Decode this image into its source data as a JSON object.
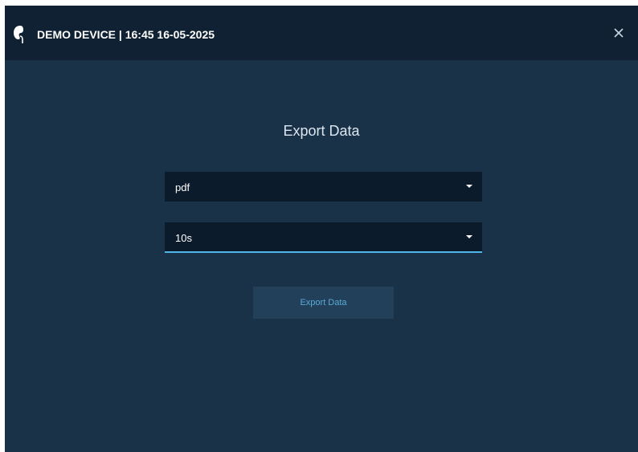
{
  "titlebar": {
    "title": "DEMO DEVICE | 16:45 16-05-2025",
    "app_icon": "kidney-icon",
    "close_icon": "close-icon"
  },
  "dialog": {
    "heading": "Export Data",
    "format_select": {
      "value": "pdf",
      "icon": "caret-down-icon"
    },
    "duration_select": {
      "value": "10s",
      "icon": "caret-down-icon"
    },
    "export_button_label": "Export Data"
  },
  "colors": {
    "background": "#1a3248",
    "titlebar": "#0f2132",
    "select_background": "#0c1b2b",
    "focus_underline": "#4fb7ea",
    "button_background": "#22405a",
    "button_text": "#5aa9d6"
  }
}
